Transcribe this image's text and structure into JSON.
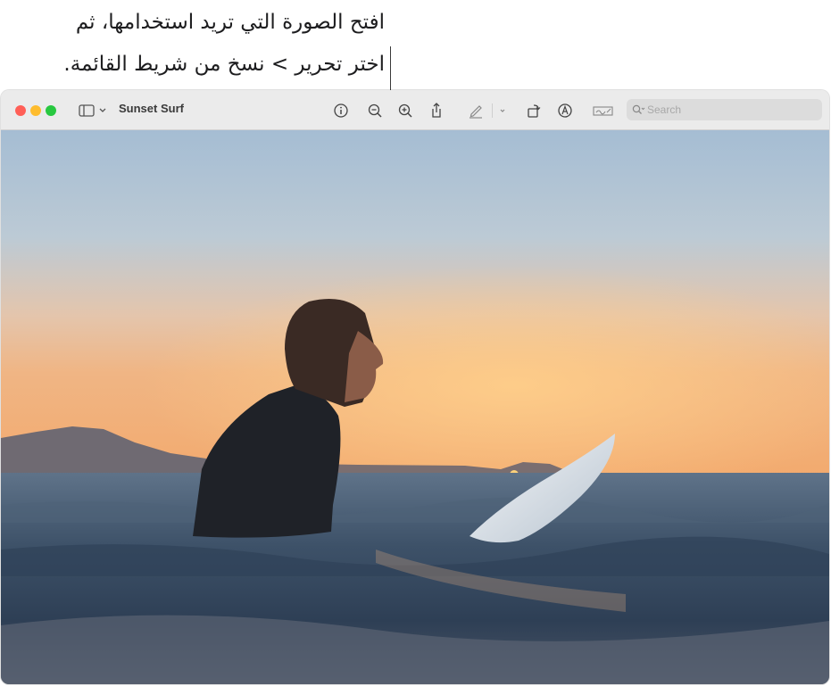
{
  "callout": {
    "line1": "افتح الصورة التي تريد استخدامها، ثم",
    "line2": "اختر تحرير > نسخ من شريط القائمة."
  },
  "window": {
    "title": "Sunset Surf",
    "search_placeholder": "Search"
  },
  "toolbar_icons": [
    "sidebar-icon",
    "chevron-down-icon",
    "info-icon",
    "zoom-out-icon",
    "zoom-in-icon",
    "share-icon",
    "markup-pen-icon",
    "chevron-down-icon",
    "rotate-icon",
    "annotate-icon",
    "signature-icon",
    "search-icon"
  ],
  "colors": {
    "close": "#ff5f57",
    "minimize": "#febc2e",
    "zoom": "#28c840"
  }
}
